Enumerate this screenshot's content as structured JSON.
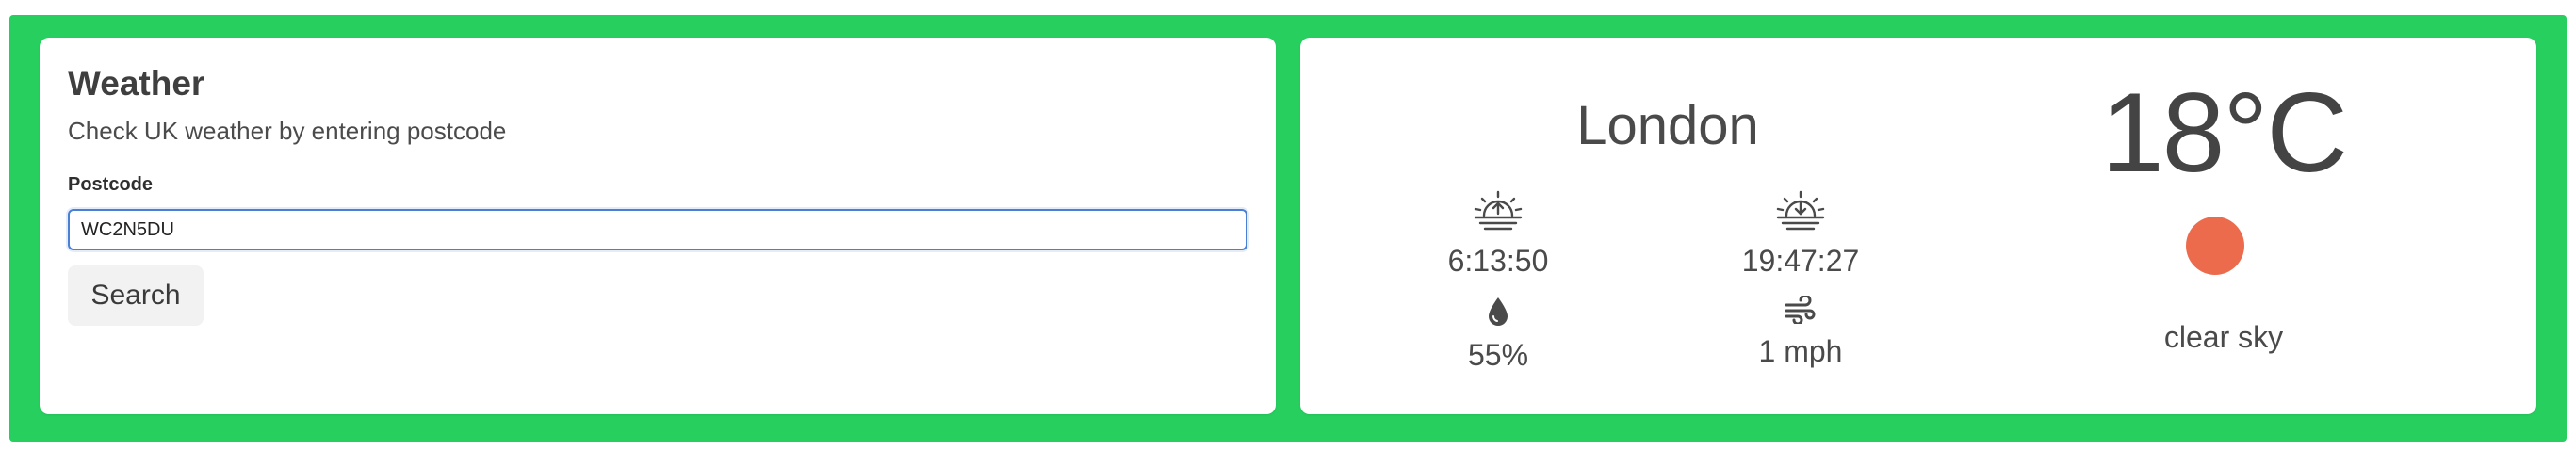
{
  "form": {
    "title": "Weather",
    "subtitle": "Check UK weather by entering postcode",
    "postcode_label": "Postcode",
    "postcode_value": "WC2N5DU",
    "search_label": "Search"
  },
  "weather": {
    "city": "London",
    "temperature": "18°C",
    "condition": "clear sky",
    "sunrise": "6:13:50",
    "sunset": "19:47:27",
    "humidity": "55%",
    "wind": "1 mph"
  },
  "colors": {
    "frame": "#27cf5f",
    "input_border": "#4a7fd6",
    "sun": "#ec6b4d"
  }
}
